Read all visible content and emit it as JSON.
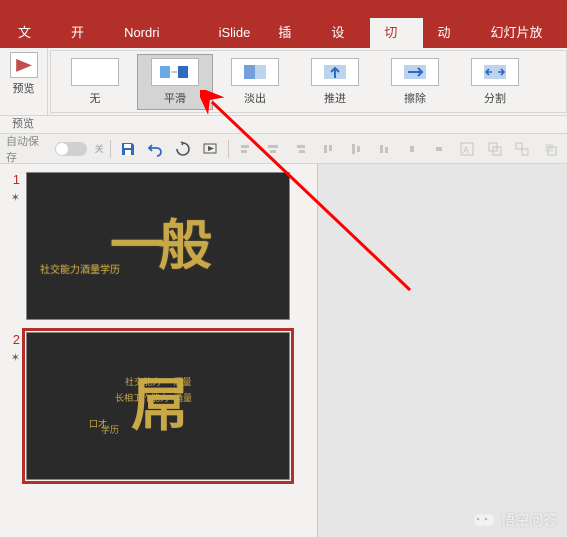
{
  "tabs": {
    "file": "文件",
    "home": "开始",
    "nordri": "Nordri Tools",
    "islide": "iSlide",
    "insert": "插入",
    "design": "设计",
    "transitions": "切换",
    "animations": "动画",
    "slideshow": "幻灯片放映"
  },
  "ribbon": {
    "preview": "预览",
    "preview_section": "预览",
    "transitions": {
      "none": "无",
      "morph": "平滑",
      "fade": "淡出",
      "push": "推进",
      "wipe": "擦除",
      "split": "分割"
    }
  },
  "qat": {
    "autosave_label": "自动保存",
    "autosave_off": "关"
  },
  "slides": [
    {
      "number": "1",
      "text": "一般",
      "tags": "社交能力酒量学历"
    },
    {
      "number": "2",
      "text": "屌",
      "tag1": "社交能力",
      "tag1b": "酒量",
      "tag2": "长相工作能力",
      "tag2b": "酒量",
      "tag3": "学历",
      "tag4": "口才"
    }
  ],
  "watermark": {
    "text": "悟空问答"
  }
}
